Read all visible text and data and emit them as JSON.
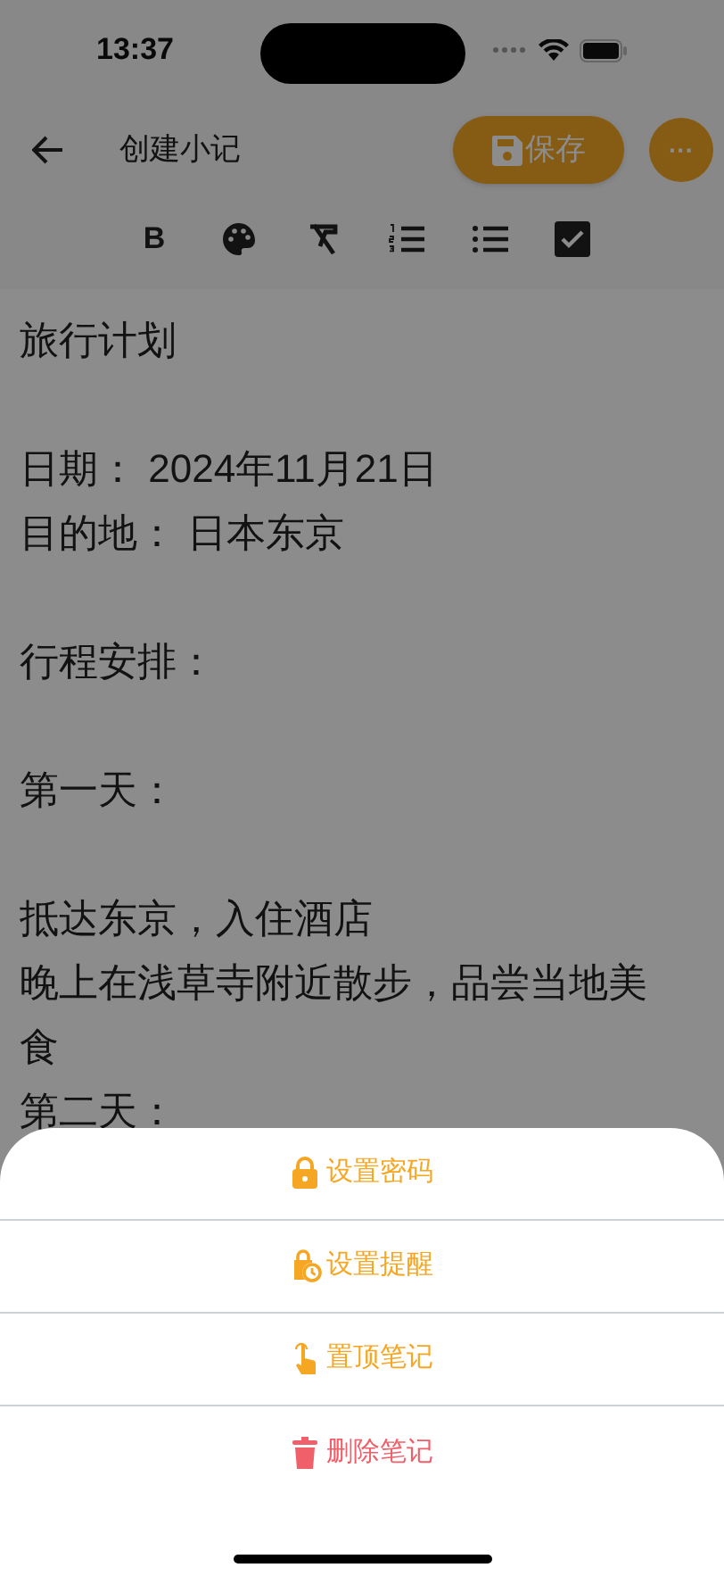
{
  "status_bar": {
    "time": "13:37"
  },
  "header": {
    "title": "创建小记",
    "save_button": "保存",
    "more_button": "···"
  },
  "toolbar": {
    "bold": "B"
  },
  "note": {
    "paragraphs": [
      [
        "旅行计划"
      ],
      [
        "日期： 2024年11月21日",
        "目的地： 日本东京"
      ],
      [
        "行程安排："
      ],
      [
        "第一天："
      ],
      [
        "抵达东京，入住酒店",
        "晚上在浅草寺附近散步，品尝当地美食",
        "第二天："
      ]
    ]
  },
  "action_sheet": {
    "items": [
      {
        "label": "设置密码",
        "kind": "normal"
      },
      {
        "label": "设置提醒",
        "kind": "normal"
      },
      {
        "label": "置顶笔记",
        "kind": "normal"
      },
      {
        "label": "删除笔记",
        "kind": "danger"
      }
    ]
  }
}
